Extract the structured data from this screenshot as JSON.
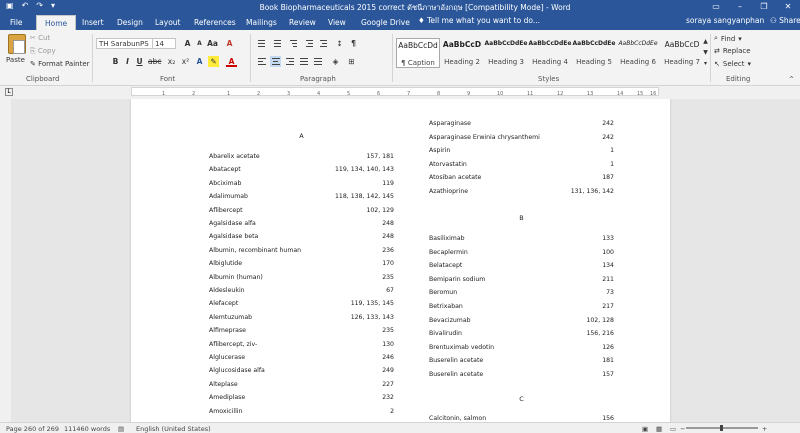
{
  "window": {
    "title": "Book Biopharmaceuticals 2015 correct ดัชนีภาษาอังกฤษ [Compatibility Mode] - Word",
    "user": "soraya sangyanphan",
    "share_label": "Share",
    "help_icon": "?"
  },
  "tabs": [
    "File",
    "Home",
    "Insert",
    "Design",
    "Layout",
    "References",
    "Mailings",
    "Review",
    "View",
    "Google Drive"
  ],
  "active_tab": "Home",
  "tellme": "Tell me what you want to do...",
  "clipboard": {
    "paste": "Paste",
    "cut": "Cut",
    "copy": "Copy",
    "format_painter": "Format Painter",
    "label": "Clipboard"
  },
  "font": {
    "name": "TH SarabunPS",
    "size": "14",
    "bold": "B",
    "italic": "I",
    "underline": "U",
    "label": "Font",
    "clear": "A"
  },
  "paragraph": {
    "label": "Paragraph",
    "show_marks": "¶"
  },
  "styles": {
    "label": "Styles",
    "items": [
      {
        "preview": "AaBbCcDd",
        "name": "¶ Caption"
      },
      {
        "preview": "AaBbCcD",
        "name": "Heading 2"
      },
      {
        "preview": "AaBbCcDdEe",
        "name": "Heading 3"
      },
      {
        "preview": "AaBbCcDdEe",
        "name": "Heading 4"
      },
      {
        "preview": "AaBbCcDdEe",
        "name": "Heading 5"
      },
      {
        "preview": "AaBbCcDdEe",
        "name": "Heading 6"
      },
      {
        "preview": "AaBbCcD",
        "name": "Heading 7"
      }
    ]
  },
  "editing": {
    "find": "Find",
    "replace": "Replace",
    "select": "Select",
    "label": "Editing"
  },
  "ruler": {
    "ticks": [
      "1",
      "2",
      "1",
      "2",
      "3",
      "4",
      "5",
      "6",
      "7",
      "8",
      "9",
      "10",
      "11",
      "12",
      "13",
      "14",
      "15",
      "16"
    ],
    "corner": "L"
  },
  "document": {
    "left": {
      "heading": "A",
      "entries": [
        {
          "name": "Abarelix acetate",
          "pages": "157, 181"
        },
        {
          "name": "Abatacept",
          "pages": "119, 134, 140, 143"
        },
        {
          "name": "Abciximab",
          "pages": "119"
        },
        {
          "name": "Adalimumab",
          "pages": "118, 138, 142, 145"
        },
        {
          "name": "Aflibercept",
          "pages": "102, 129"
        },
        {
          "name": "Agalsidase alfa",
          "pages": "248"
        },
        {
          "name": "Agalsidase beta",
          "pages": "248"
        },
        {
          "name": "Albumin, recombinant human",
          "pages": "236"
        },
        {
          "name": "Albiglutide",
          "pages": "170"
        },
        {
          "name": "Albumin (human)",
          "pages": "235"
        },
        {
          "name": "Aldesleukin",
          "pages": "67"
        },
        {
          "name": "Alefacept",
          "pages": "119, 135, 145"
        },
        {
          "name": "Alemtuzumab",
          "pages": "126, 133, 143"
        },
        {
          "name": "Alfimeprase",
          "pages": "235"
        },
        {
          "name": "Aflibercept, ziv-",
          "pages": "130"
        },
        {
          "name": "Alglucerase",
          "pages": "246"
        },
        {
          "name": "Alglucosidase alfa",
          "pages": "249"
        },
        {
          "name": "Alteplase",
          "pages": "227"
        },
        {
          "name": "Amediplase",
          "pages": "232"
        },
        {
          "name": "Amoxicillin",
          "pages": "2"
        }
      ]
    },
    "right_a": [
      {
        "name": "Asparaginase",
        "pages": "242"
      },
      {
        "name": "Asparaginase Erwinia chrysanthemi",
        "pages": "242"
      },
      {
        "name": "Aspirin",
        "pages": "1"
      },
      {
        "name": "Atorvastatin",
        "pages": "1"
      },
      {
        "name": "Atosiban acetate",
        "pages": "187"
      },
      {
        "name": "Azathioprine",
        "pages": "131, 136, 142"
      }
    ],
    "right_b_heading": "B",
    "right_b": [
      {
        "name": "Basiliximab",
        "pages": "133"
      },
      {
        "name": "Becaplermin",
        "pages": "100"
      },
      {
        "name": "Belatacept",
        "pages": "134"
      },
      {
        "name": "Bemiparin sodium",
        "pages": "211"
      },
      {
        "name": "Beromun",
        "pages": "73"
      },
      {
        "name": "Betrixaban",
        "pages": "217"
      },
      {
        "name": "Bevacizumab",
        "pages": "102, 128"
      },
      {
        "name": "Bivalirudin",
        "pages": "156, 216"
      },
      {
        "name": "Brentuximab vedotin",
        "pages": "126"
      },
      {
        "name": "Buserelin acetate",
        "pages": "181"
      },
      {
        "name": "Buserelin acetate",
        "pages": "157"
      }
    ],
    "right_c_heading": "C",
    "right_c": [
      {
        "name": "Calcitonin, salmon",
        "pages": "156"
      }
    ]
  },
  "status": {
    "page": "Page 260 of 269",
    "words": "111460 words",
    "language": "English (United States)"
  }
}
